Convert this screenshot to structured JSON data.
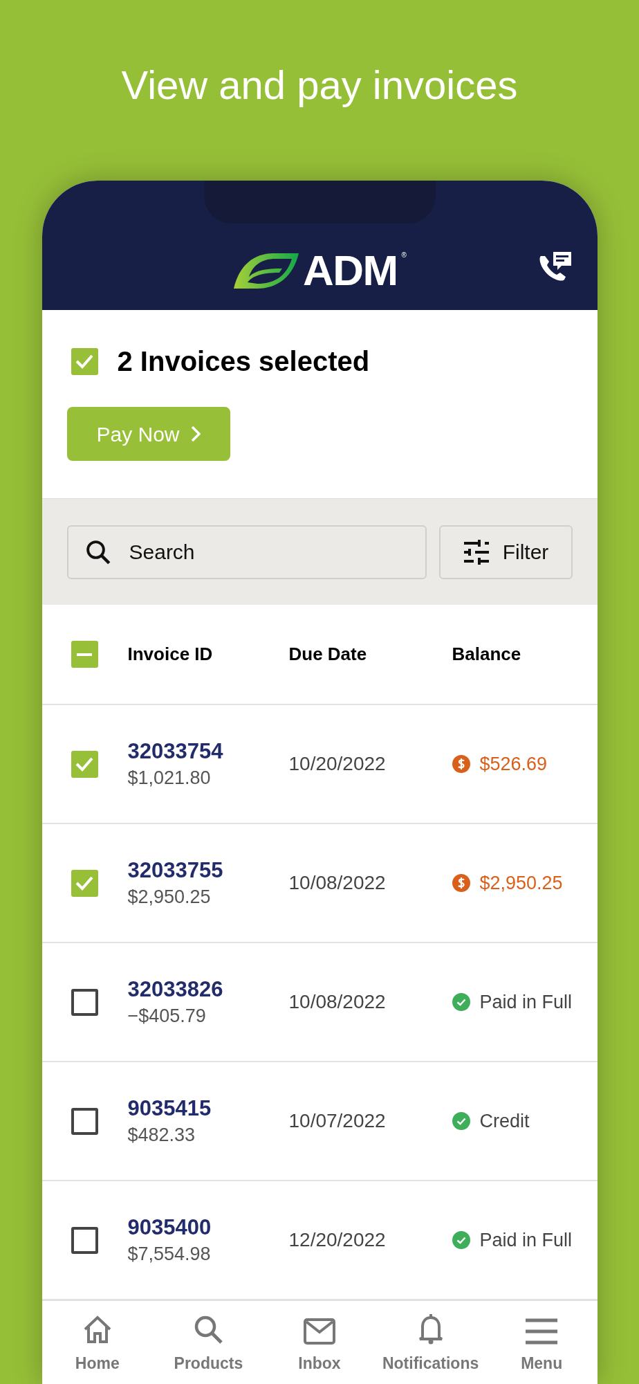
{
  "headline": "View and pay invoices",
  "header": {
    "logo_text": "ADM",
    "logo_mark": "®"
  },
  "selection": {
    "checked": true,
    "label": "2 Invoices selected",
    "button": "Pay Now"
  },
  "search": {
    "placeholder": "Search"
  },
  "filter_button": "Filter",
  "table": {
    "header_checkbox": {
      "indeterminate": true
    },
    "columns": [
      "Invoice ID",
      "Due Date",
      "Balance"
    ],
    "rows": [
      {
        "checked": true,
        "invoice_id": "32033754",
        "amount": "$1,021.80",
        "due_date": "10/20/2022",
        "balance": {
          "kind": "due",
          "text": "$526.69"
        }
      },
      {
        "checked": true,
        "invoice_id": "32033755",
        "amount": "$2,950.25",
        "due_date": "10/08/2022",
        "balance": {
          "kind": "due",
          "text": "$2,950.25"
        }
      },
      {
        "checked": false,
        "invoice_id": "32033826",
        "amount": "−$405.79",
        "due_date": "10/08/2022",
        "balance": {
          "kind": "paid",
          "text": "Paid in Full"
        }
      },
      {
        "checked": false,
        "invoice_id": "9035415",
        "amount": "$482.33",
        "due_date": "10/07/2022",
        "balance": {
          "kind": "paid",
          "text": "Credit"
        }
      },
      {
        "checked": false,
        "invoice_id": "9035400",
        "amount": "$7,554.98",
        "due_date": "12/20/2022",
        "balance": {
          "kind": "paid",
          "text": "Paid in Full"
        }
      }
    ]
  },
  "bottom_nav": [
    {
      "kind": "home",
      "label": "Home"
    },
    {
      "kind": "search",
      "label": "Products"
    },
    {
      "kind": "inbox",
      "label": "Inbox"
    },
    {
      "kind": "bell",
      "label": "Notifications"
    },
    {
      "kind": "menu",
      "label": "Menu"
    }
  ]
}
